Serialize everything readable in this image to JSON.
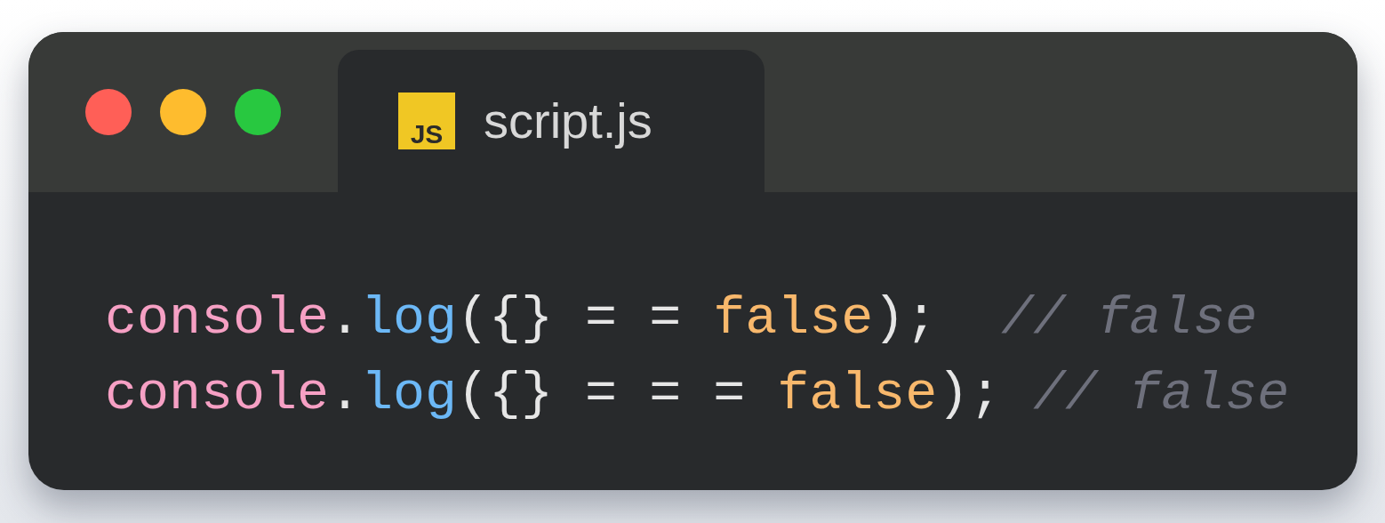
{
  "tab": {
    "badge": "JS",
    "label": "script.js",
    "selected": true
  },
  "code_lines": [
    [
      {
        "kind": "object",
        "text": "console"
      },
      {
        "kind": "punct",
        "text": "."
      },
      {
        "kind": "method",
        "text": "log"
      },
      {
        "kind": "punct",
        "text": "({} = = "
      },
      {
        "kind": "literal",
        "text": "false"
      },
      {
        "kind": "punct",
        "text": ");  "
      },
      {
        "kind": "comment",
        "text": "// false"
      }
    ],
    [
      {
        "kind": "object",
        "text": "console"
      },
      {
        "kind": "punct",
        "text": "."
      },
      {
        "kind": "method",
        "text": "log"
      },
      {
        "kind": "punct",
        "text": "({} = = = "
      },
      {
        "kind": "literal",
        "text": "false"
      },
      {
        "kind": "punct",
        "text": "); "
      },
      {
        "kind": "comment",
        "text": "// false"
      }
    ]
  ]
}
